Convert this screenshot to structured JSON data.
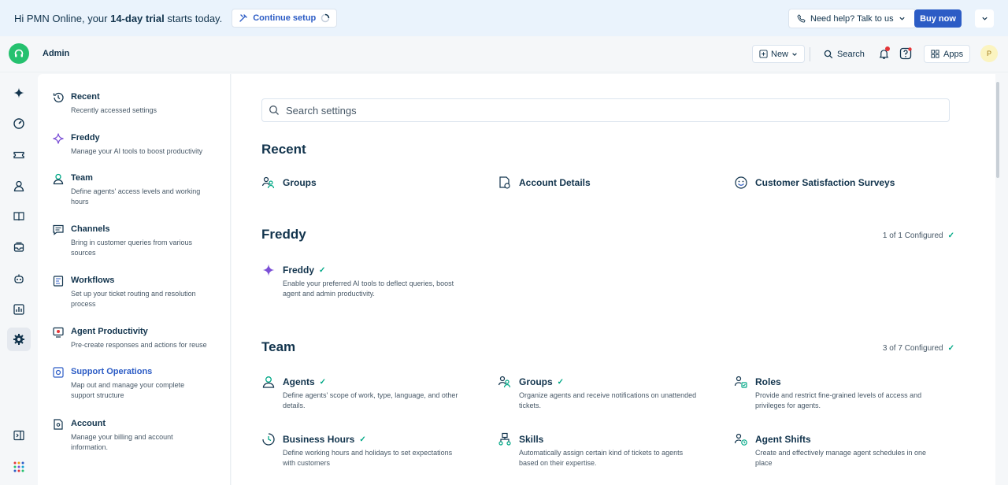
{
  "banner": {
    "greeting": "Hi PMN Online, your ",
    "trial": "14-day trial",
    "suffix": " starts today.",
    "continue_setup": "Continue setup",
    "need_help": "Need help? Talk to us",
    "buy_now": "Buy now"
  },
  "header": {
    "title": "Admin",
    "new_label": "New",
    "search_label": "Search",
    "apps_label": "Apps",
    "avatar_initial": "P"
  },
  "rail": {
    "items": [
      "sparkle-icon",
      "dashboard-icon",
      "ticket-icon",
      "contacts-icon",
      "book-icon",
      "inbox-icon",
      "bot-icon",
      "reports-icon",
      "settings-icon"
    ]
  },
  "categories": [
    {
      "title": "Recent",
      "desc": "Recently accessed settings",
      "icon": "history-icon"
    },
    {
      "title": "Freddy",
      "desc": "Manage your AI tools to boost productivity",
      "icon": "sparkle-icon"
    },
    {
      "title": "Team",
      "desc": "Define agents' access levels and working hours",
      "icon": "person-icon"
    },
    {
      "title": "Channels",
      "desc": "Bring in customer queries from various sources",
      "icon": "message-icon"
    },
    {
      "title": "Workflows",
      "desc": "Set up your ticket routing and resolution process",
      "icon": "workflow-icon"
    },
    {
      "title": "Agent Productivity",
      "desc": "Pre-create responses and actions for reuse",
      "icon": "canned-response-icon"
    },
    {
      "title": "Support Operations",
      "desc": "Map out and manage your complete support structure",
      "icon": "operations-icon"
    },
    {
      "title": "Account",
      "desc": "Manage your billing and account information.",
      "icon": "account-icon"
    }
  ],
  "search": {
    "placeholder": "Search settings"
  },
  "recent": {
    "title": "Recent",
    "items": [
      "Groups",
      "Account Details",
      "Customer Satisfaction Surveys"
    ]
  },
  "freddy": {
    "title": "Freddy",
    "count": "1 of 1 Configured",
    "item_title": "Freddy",
    "item_desc": "Enable your preferred AI tools to deflect queries, boost agent and admin productivity."
  },
  "team": {
    "title": "Team",
    "count": "3 of 7 Configured",
    "items": [
      {
        "title": "Agents",
        "desc": "Define agents' scope of work, type, language, and other details.",
        "configured": true
      },
      {
        "title": "Groups",
        "desc": "Organize agents and receive notifications on unattended tickets.",
        "configured": true
      },
      {
        "title": "Roles",
        "desc": "Provide and restrict fine-grained levels of access and privileges for agents.",
        "configured": false
      },
      {
        "title": "Business Hours",
        "desc": "Define working hours and holidays to set expectations with customers",
        "configured": true
      },
      {
        "title": "Skills",
        "desc": "Automatically assign certain kind of tickets to agents based on their expertise.",
        "configured": false
      },
      {
        "title": "Agent Shifts",
        "desc": "Create and effectively manage agent schedules in one place",
        "configured": false
      }
    ]
  },
  "colors": {
    "accent": "#2c5cc5",
    "brand_green": "#25c16f",
    "check_green": "#00a886",
    "freddy_purple": "#7b4fd6"
  }
}
